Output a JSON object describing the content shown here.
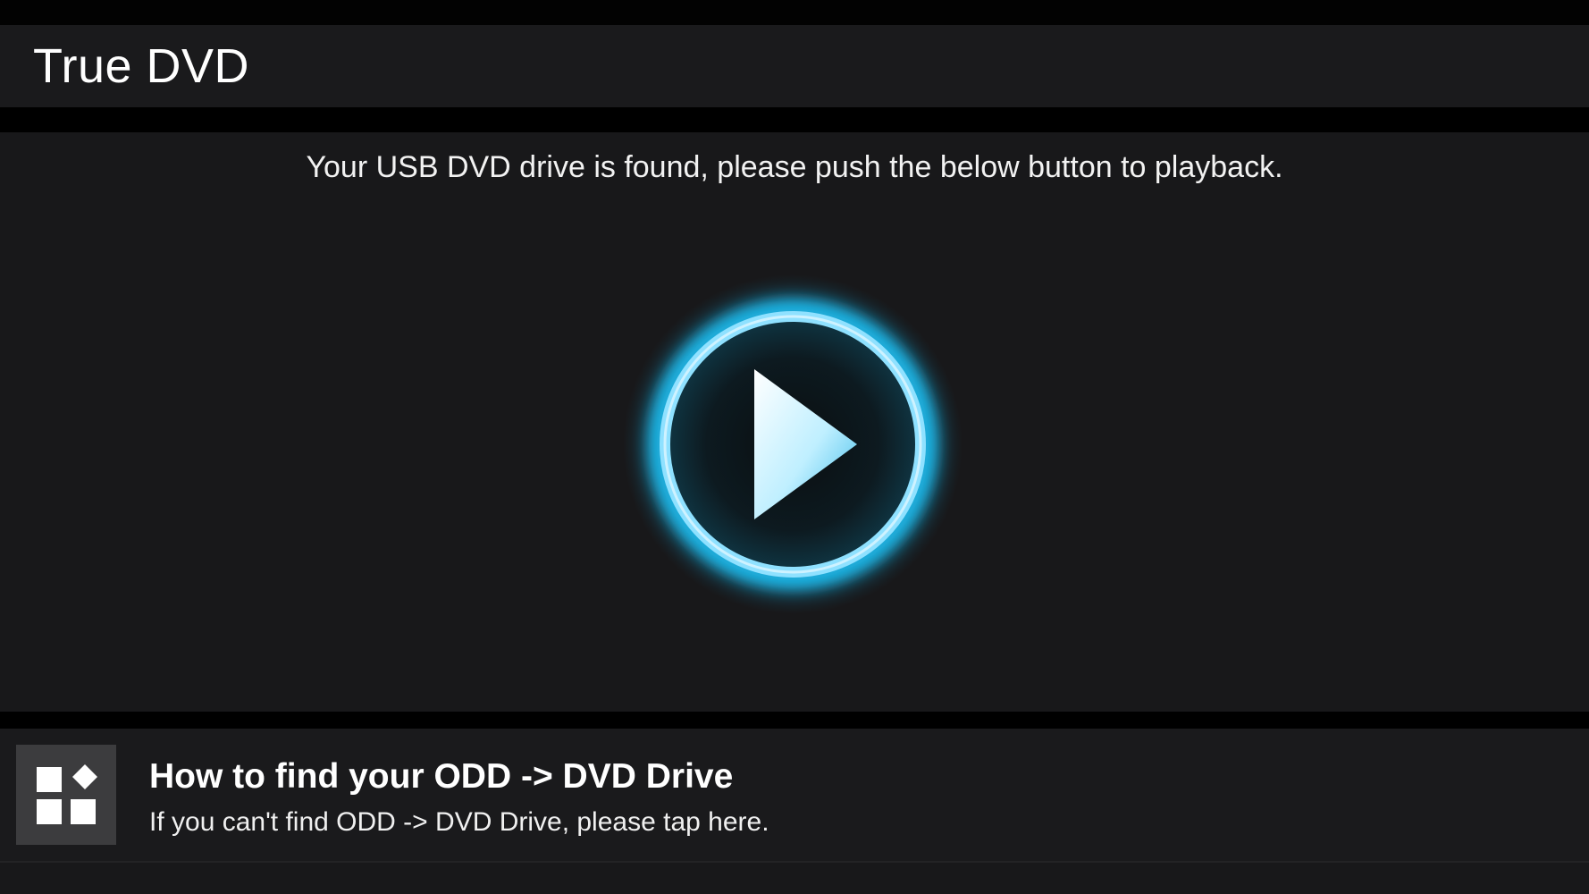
{
  "app": {
    "title": "True DVD"
  },
  "main": {
    "message": "Your USB DVD drive is found, please push the below button to playback.",
    "play_button_icon": "play-circle-icon"
  },
  "footer": {
    "icon": "apps-grid-icon",
    "title": "How to find your ODD -> DVD Drive",
    "subtitle": "If you can't find ODD -> DVD Drive, please tap here."
  },
  "colors": {
    "background": "#000000",
    "panel": "#18181a",
    "app_bar": "#1a1a1c",
    "accent_glow": "#1fb6e6",
    "accent_light": "#7fdcff",
    "icon_tile": "#3c3c3e"
  }
}
